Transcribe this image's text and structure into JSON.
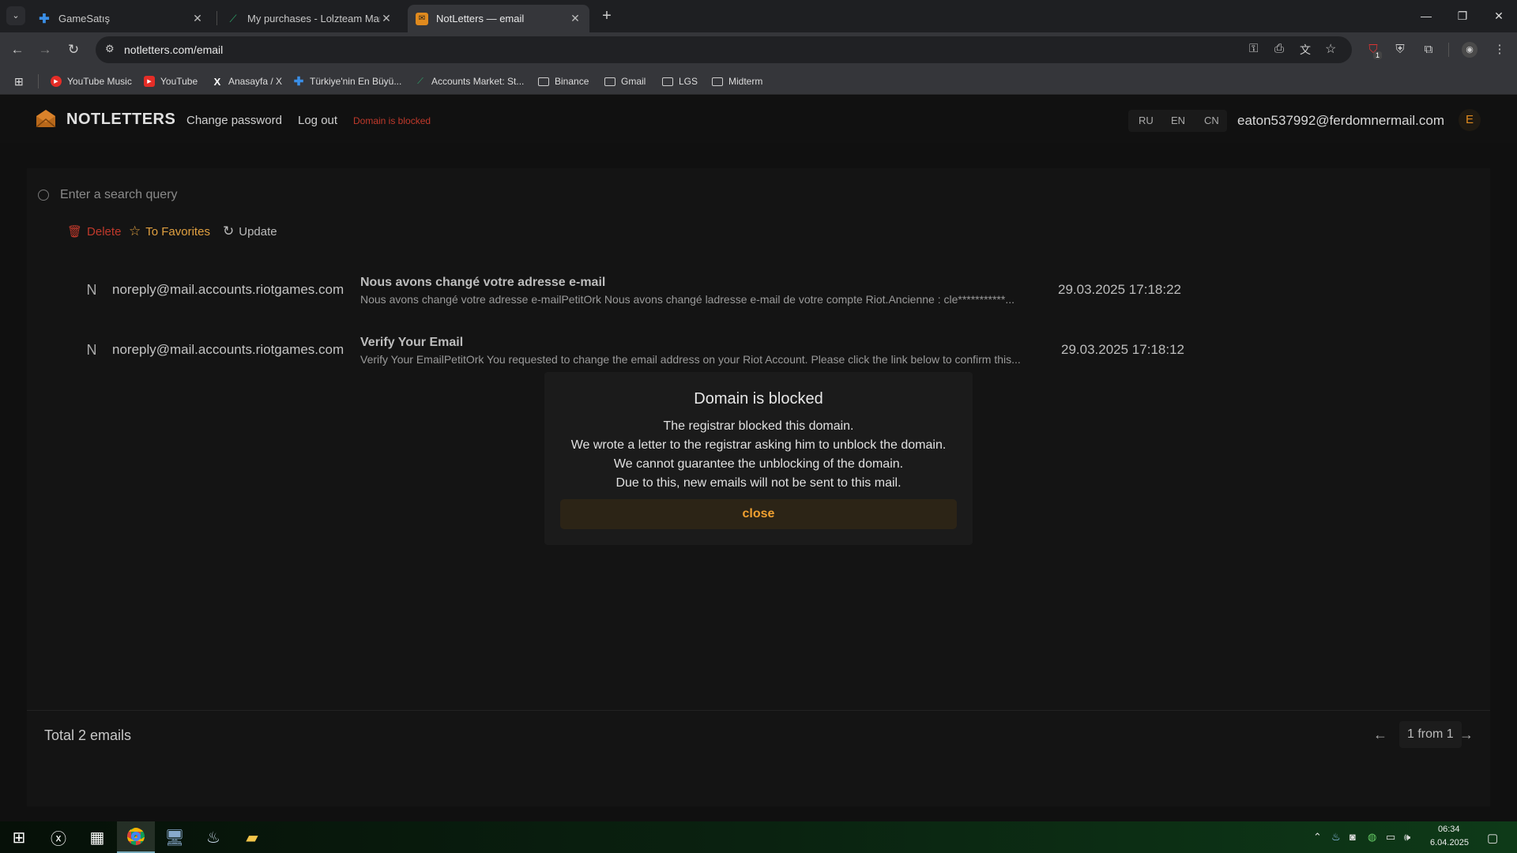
{
  "browser": {
    "tabs": [
      {
        "title": "GameSatış",
        "active": false
      },
      {
        "title": "My purchases - Lolzteam Marke",
        "active": false
      },
      {
        "title": "NotLetters — email",
        "active": true
      }
    ],
    "url": "notletters.com/email",
    "bookmarks": [
      {
        "label": "YouTube Music",
        "icon": "youtube-music-icon"
      },
      {
        "label": "YouTube",
        "icon": "youtube-icon"
      },
      {
        "label": "Anasayfa / X",
        "icon": "x-icon"
      },
      {
        "label": "Türkiye'nin En Büyü...",
        "icon": "plus-icon"
      },
      {
        "label": "Accounts Market: St...",
        "icon": "market-icon"
      },
      {
        "label": "Binance",
        "icon": "folder-icon"
      },
      {
        "label": "Gmail",
        "icon": "folder-icon"
      },
      {
        "label": "LGS",
        "icon": "folder-icon"
      },
      {
        "label": "Midterm",
        "icon": "folder-icon"
      }
    ],
    "extension_badge": "1"
  },
  "site": {
    "brand": "NOTLETTERS",
    "nav": {
      "change_password": "Change password",
      "logout": "Log out",
      "status": "Domain is blocked"
    },
    "languages": [
      "RU",
      "EN",
      "CN"
    ],
    "user_email": "eaton537992@ferdomnermail.com",
    "user_initial": "E",
    "accent": "#f0a030",
    "danger": "#c0392b"
  },
  "mail": {
    "search_placeholder": "Enter a search query",
    "actions": {
      "delete": "Delete",
      "favorites": "To Favorites",
      "update": "Update"
    },
    "emails": [
      {
        "initial": "N",
        "sender": "noreply@mail.accounts.riotgames.com",
        "subject": "Nous avons changé votre adresse e-mail",
        "snippet": "Nous avons changé votre adresse e-mailPetitOrk Nous avons changé ladresse e-mail de votre compte Riot.Ancienne : cle***********...",
        "date": "29.03.2025 17:18:22"
      },
      {
        "initial": "N",
        "sender": "noreply@mail.accounts.riotgames.com",
        "subject": "Verify Your Email",
        "snippet": "Verify Your EmailPetitOrk You requested to change the email address on your Riot Account. Please click the link below to confirm this...",
        "date": "29.03.2025 17:18:12"
      }
    ],
    "total": "Total 2 emails",
    "pagination": "1 from 1"
  },
  "modal": {
    "title": "Domain is blocked",
    "lines": [
      "The registrar blocked this domain.",
      "We wrote a letter to the registrar asking him to unblock the domain.",
      "We cannot guarantee the unblocking of the domain.",
      "Due to this, new emails will not be sent to this mail."
    ],
    "close": "close"
  },
  "taskbar": {
    "time": "06:34",
    "date": "6.04.2025"
  }
}
